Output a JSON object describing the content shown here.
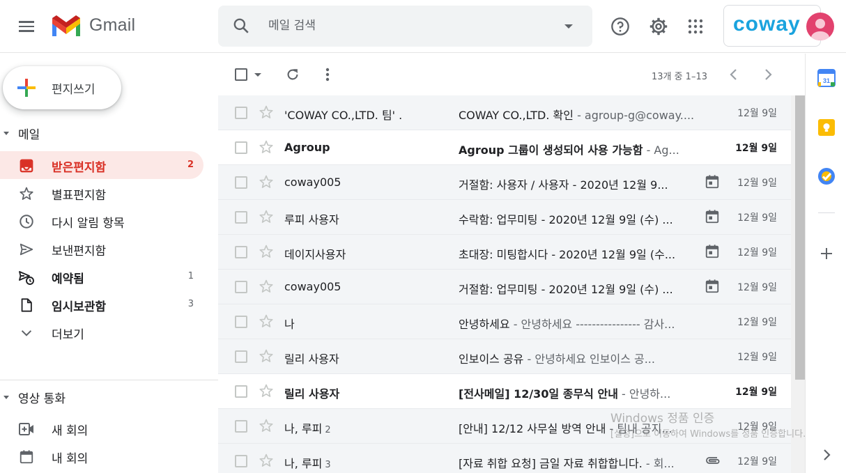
{
  "header": {
    "app_name": "Gmail",
    "search_placeholder": "메일 검색",
    "account_brand": "coway"
  },
  "compose": {
    "label": "편지쓰기"
  },
  "sidebar": {
    "mail_section": "메일",
    "items": [
      {
        "label": "받은편지함",
        "count": "2",
        "icon": "inbox-icon"
      },
      {
        "label": "별표편지함",
        "count": "",
        "icon": "star-icon"
      },
      {
        "label": "다시 알림 항목",
        "count": "",
        "icon": "clock-icon"
      },
      {
        "label": "보낸편지함",
        "count": "",
        "icon": "send-icon"
      },
      {
        "label": "예약됨",
        "count": "1",
        "icon": "scheduled-icon"
      },
      {
        "label": "임시보관함",
        "count": "3",
        "icon": "draft-icon"
      },
      {
        "label": "더보기",
        "count": "",
        "icon": "chevron-down-icon"
      }
    ],
    "meet_section": "영상 통화",
    "meet_items": [
      {
        "label": "새 회의",
        "icon": "new-meeting-icon"
      },
      {
        "label": "내 회의",
        "icon": "calendar-icon"
      }
    ]
  },
  "toolbar": {
    "pagination": "13개 중 1–13"
  },
  "emails": [
    {
      "sender": "'COWAY CO.,LTD. 팀' .",
      "count": "",
      "subject": "COWAY CO.,LTD. 확인",
      "snippet": " - agroup-g@coway....",
      "date": "12월 9일",
      "unread": false,
      "attachment": ""
    },
    {
      "sender": "Agroup",
      "count": "",
      "subject": "Agroup 그룹이 생성되어 사용 가능함",
      "snippet": " - Ag...",
      "date": "12월 9일",
      "unread": true,
      "attachment": ""
    },
    {
      "sender": "coway005",
      "count": "",
      "subject": "거절함: 사용자 / 사용자 - 2020년 12월 9...",
      "snippet": "",
      "date": "12월 9일",
      "unread": false,
      "attachment": "calendar"
    },
    {
      "sender": "루피 사용자",
      "count": "",
      "subject": "수락함: 업무미팅 - 2020년 12월 9일 (수) ...",
      "snippet": "",
      "date": "12월 9일",
      "unread": false,
      "attachment": "calendar"
    },
    {
      "sender": "데이지사용자",
      "count": "",
      "subject": "초대장: 미팅합시다 - 2020년 12월 9일 (수...",
      "snippet": "",
      "date": "12월 9일",
      "unread": false,
      "attachment": "calendar"
    },
    {
      "sender": "coway005",
      "count": "",
      "subject": "거절함: 업무미팅 - 2020년 12월 9일 (수) ...",
      "snippet": "",
      "date": "12월 9일",
      "unread": false,
      "attachment": "calendar"
    },
    {
      "sender": "나",
      "count": "",
      "subject": "안녕하세요",
      "snippet": " - 안녕하세요 ---------------- 감사...",
      "date": "12월 9일",
      "unread": false,
      "attachment": ""
    },
    {
      "sender": "릴리 사용자",
      "count": "",
      "subject": "인보이스 공유",
      "snippet": " - 안녕하세요 인보이스 공...",
      "date": "12월 9일",
      "unread": false,
      "attachment": ""
    },
    {
      "sender": "릴리 사용자",
      "count": "",
      "subject": "[전사메일] 12/30일 종무식 안내",
      "snippet": " - 안녕하...",
      "date": "12월 9일",
      "unread": true,
      "attachment": ""
    },
    {
      "sender": "나, 루피",
      "count": "2",
      "subject": "[안내] 12/12 사무실 방역 안내",
      "snippet": " - 팀내 공지...",
      "date": "12월 9일",
      "unread": false,
      "attachment": ""
    },
    {
      "sender": "나, 루피",
      "count": "3",
      "subject": "[자료 취합 요청] 금일 자료 취합합니다.",
      "snippet": " - 회...",
      "date": "12월 9일",
      "unread": false,
      "attachment": "clip"
    }
  ],
  "watermark": {
    "title": "Windows 정품 인증",
    "text": "[설정]으로 이동하여 Windows를 정품 인증합니다."
  },
  "colors": {
    "accent_red": "#d93025",
    "active_bg": "#fce8e6",
    "brand_blue": "#1aa3de"
  }
}
